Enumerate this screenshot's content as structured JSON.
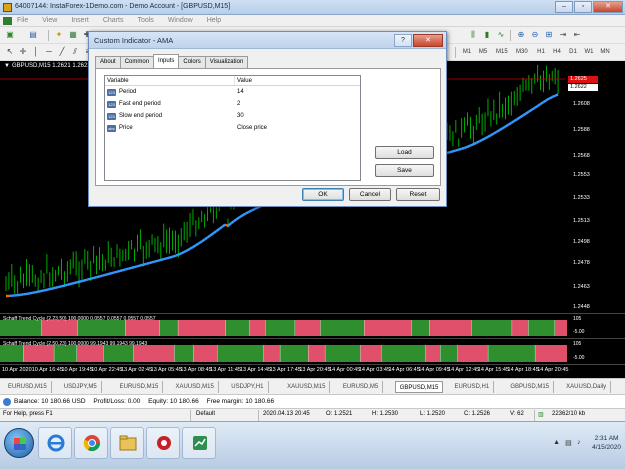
{
  "window": {
    "title": "64007144: InstaForex-1Demo.com - Demo Account - [GBPUSD,M15]",
    "controls": [
      "–",
      "▫",
      "✕"
    ]
  },
  "menu": [
    "File",
    "View",
    "Insert",
    "Charts",
    "Tools",
    "Window",
    "Help"
  ],
  "chart": {
    "label": "GBPUSD,M15  1.2621 1.2622 1...",
    "price_ticks": [
      "1.2608",
      "1.2588",
      "1.2568",
      "1.2553",
      "1.2533",
      "1.2513",
      "1.2498",
      "1.2478",
      "1.2463",
      "1.2448"
    ],
    "price_tag_red": "1.2625",
    "price_tag_white": "1.2622",
    "colors": {
      "background": "#000000",
      "candles": "#00c000",
      "ama_up": "#3399ff",
      "ama_down": "#ff6600"
    }
  },
  "indicators": [
    {
      "label": "Schaff Trend Cycle (2,23,50) 100.0000 0.0557 0.0557 0.0557 0.0557",
      "ticks": [
        "105",
        "-5.00"
      ]
    },
    {
      "label": "Schaff Trend Cycle (2,50,23) 100.0000 99.1943 99.1943 99.1943",
      "ticks": [
        "105",
        "-5.00"
      ]
    }
  ],
  "time_axis": [
    "10 Apr 2020",
    "10 Apr 16:45",
    "10 Apr 19:45",
    "10 Apr 22:45",
    "13 Apr 02:45",
    "13 Apr 05:45",
    "13 Apr 08:45",
    "13 Apr 11:45",
    "13 Apr 14:45",
    "13 Apr 17:45",
    "13 Apr 20:45",
    "14 Apr 00:45",
    "14 Apr 03:45",
    "14 Apr 06:45",
    "14 Apr 09:45",
    "14 Apr 12:45",
    "14 Apr 15:45",
    "14 Apr 18:45",
    "14 Apr 20:45"
  ],
  "symbol_tabs": [
    "EURUSD,M15",
    "USDJPY,M5",
    "EURUSD,M15",
    "XAUUSD,M15",
    "USDJPY,H1",
    "XAUUSD,M15",
    "EURUSD,M5",
    "GBPUSD,M15",
    "EURUSD,H1",
    "GBPUSD,M15",
    "XAUUSD,Daily"
  ],
  "active_symbol_tab": 7,
  "balance": {
    "balance": "Balance: 10 180.66 USD",
    "profit": "Profit/Loss: 0.00",
    "equity": "Equity: 10 180.66",
    "free_margin": "Free margin: 10 180.66"
  },
  "status": {
    "help": "For Help, press F1",
    "profile": "Default",
    "datetime": "2020.04.13 20:45",
    "open": "O: 1.2521",
    "high": "H: 1.2530",
    "low": "L: 1.2520",
    "close": "C: 1.2526",
    "volume": "V: 62",
    "traffic": "22362/10 kb"
  },
  "taskbar": {
    "time": "2:31 AM",
    "date": "4/15/2020",
    "apps": [
      "ie-icon",
      "chrome-icon",
      "explorer-icon",
      "metatrader-icon",
      "tradebox-icon"
    ]
  },
  "dialog": {
    "title": "Custom Indicator - AMA",
    "help_label": "?",
    "close_label": "✕",
    "tabs": [
      "About",
      "Common",
      "Inputs",
      "Colors",
      "Visualization"
    ],
    "active_tab": 2,
    "columns": [
      "Variable",
      "Value"
    ],
    "rows": [
      {
        "badge": "123",
        "variable": "Period",
        "value": "14"
      },
      {
        "badge": "123",
        "variable": "Fast end period",
        "value": "2"
      },
      {
        "badge": "123",
        "variable": "Slow end period",
        "value": "30"
      },
      {
        "badge": "abc",
        "variable": "Price",
        "value": "Close price"
      }
    ],
    "buttons": {
      "load": "Load",
      "save": "Save",
      "ok": "OK",
      "cancel": "Cancel",
      "reset": "Reset"
    }
  }
}
